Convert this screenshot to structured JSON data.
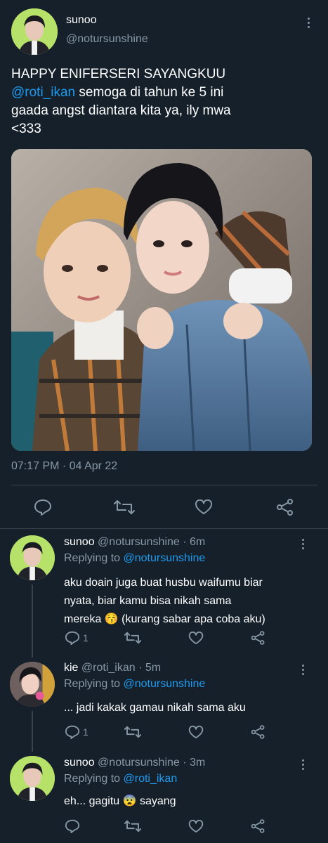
{
  "main_tweet": {
    "display_name": "sunoo",
    "handle": "@notursunshine",
    "text_line1": "HAPPY ENIFERSERI SAYANGKUU",
    "mention": "@roti_ikan",
    "text_rest1": " semoga di tahun ke 5 ini",
    "text_line3": "gaada angst diantara kita ya, ily mwa",
    "text_line4": "<333",
    "timestamp": "07:17 PM · 04 Apr 22"
  },
  "replies": [
    {
      "display_name": "sunoo",
      "handle": "@notursunshine · 6m",
      "replying_prefix": "Replying to",
      "replying_to": "@notursunshine",
      "line1": "aku doain juga buat husbu waifumu biar",
      "line2": "nyata, biar kamu bisa nikah sama",
      "line3": "mereka 😚 (kurang sabar apa coba aku)",
      "reply_count": "1"
    },
    {
      "display_name": "kie",
      "handle": "@roti_ikan · 5m",
      "replying_prefix": "Replying to",
      "replying_to": "@notursunshine",
      "line1": "... jadi kakak gamau nikah sama aku",
      "reply_count": "1"
    },
    {
      "display_name": "sunoo",
      "handle": "@notursunshine · 3m",
      "replying_prefix": "Replying to",
      "replying_to": "@roti_ikan",
      "line1": "eh... gagitu 😨 sayang",
      "reply_count": ""
    }
  ],
  "icons": {
    "reply": "reply-icon",
    "retweet": "retweet-icon",
    "like": "heart-icon",
    "share": "share-icon",
    "more": "more-icon"
  },
  "colors": {
    "background": "#15202b",
    "accent": "#1d9bf0",
    "muted": "#8899a6",
    "avatar_bg": "#b7e26a"
  }
}
